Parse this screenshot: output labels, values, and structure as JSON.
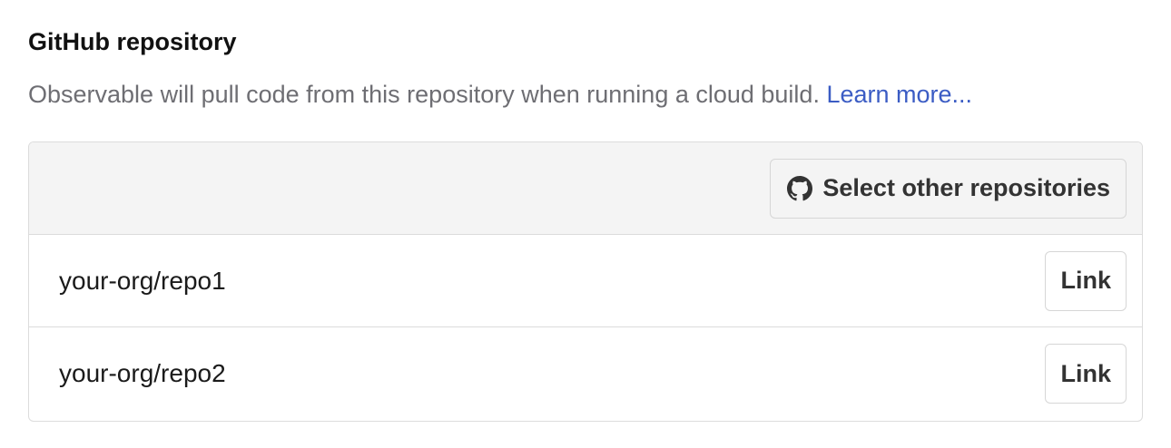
{
  "section": {
    "title": "GitHub repository",
    "description": "Observable will pull code from this repository when running a cloud build. ",
    "learn_more": "Learn more..."
  },
  "panel": {
    "select_button": {
      "icon": "github-icon",
      "label": "Select other repositories"
    },
    "repos": [
      {
        "name": "your-org/repo1",
        "action": "Link"
      },
      {
        "name": "your-org/repo2",
        "action": "Link"
      }
    ]
  },
  "colors": {
    "link": "#3b5cc4",
    "muted_text": "#6e6e73",
    "header_bg": "#f4f4f4",
    "border": "#dcdcdc"
  }
}
